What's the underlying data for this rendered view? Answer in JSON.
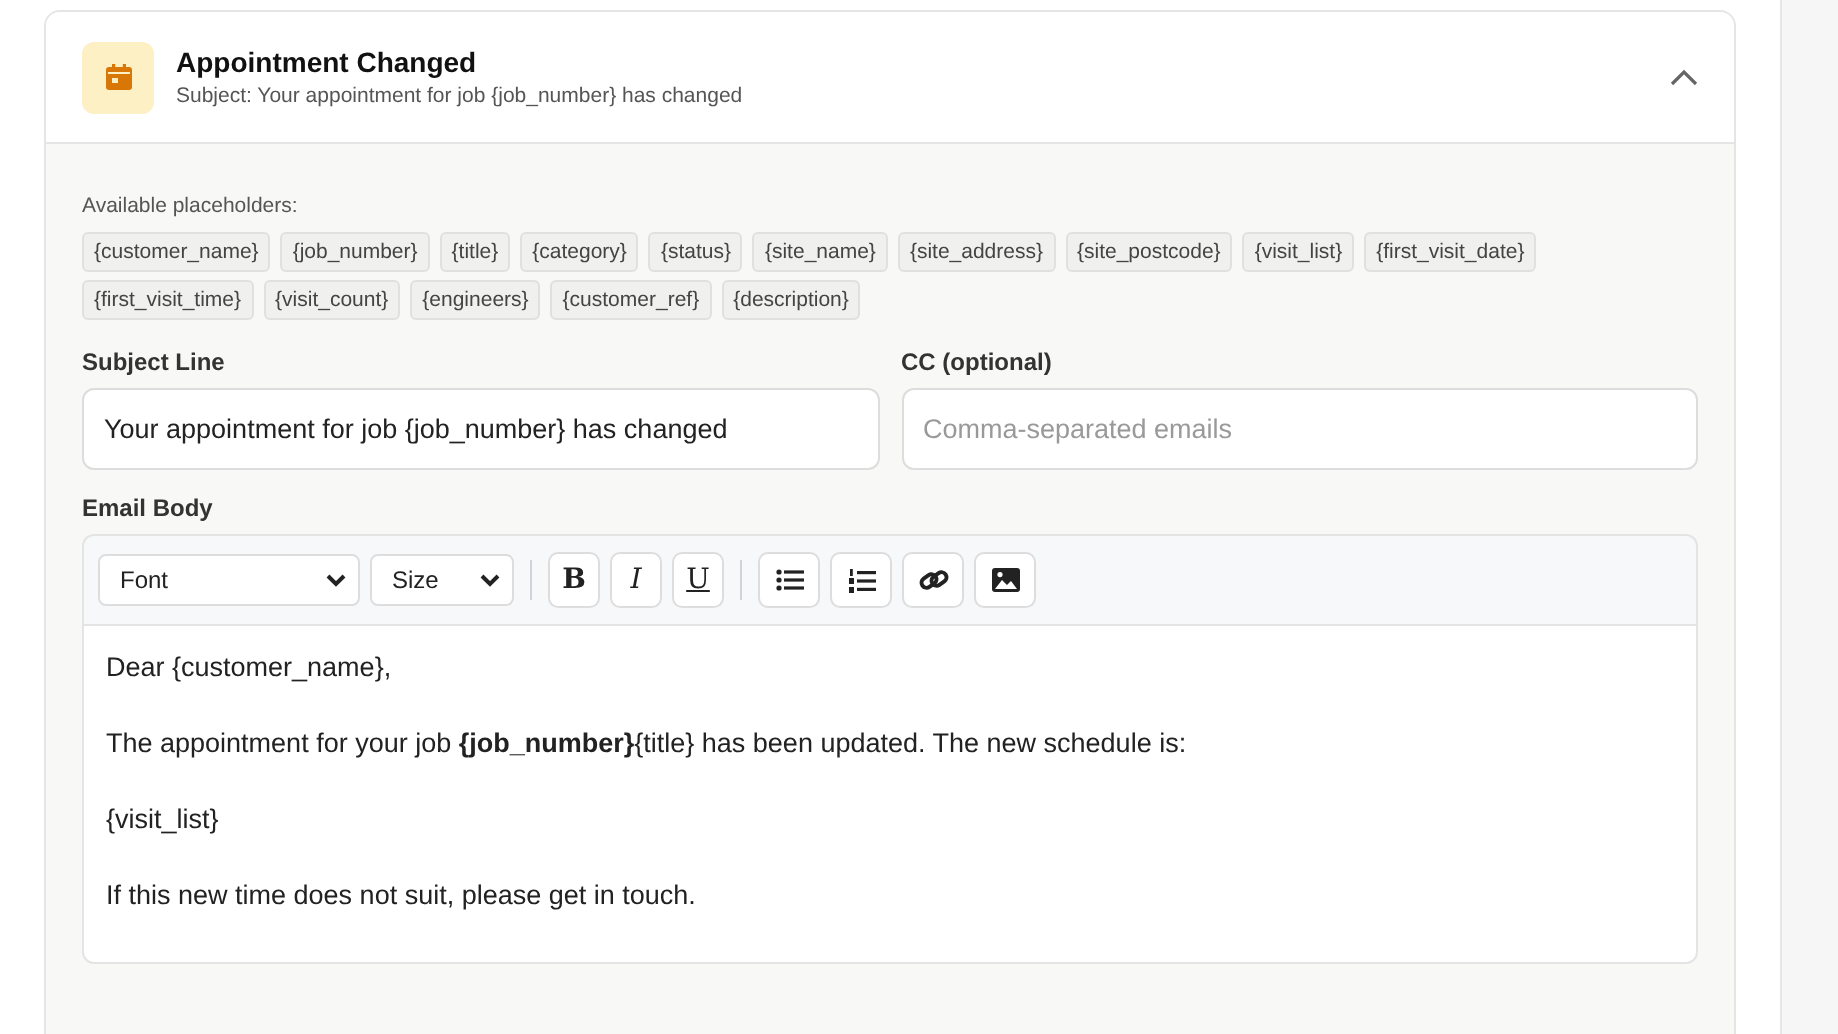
{
  "card": {
    "title": "Appointment Changed",
    "subtitle": "Subject: Your appointment for job {job_number} has changed",
    "expanded": true
  },
  "placeholders": {
    "label": "Available placeholders:",
    "items": [
      "{customer_name}",
      "{job_number}",
      "{title}",
      "{category}",
      "{status}",
      "{site_name}",
      "{site_address}",
      "{site_postcode}",
      "{visit_list}",
      "{first_visit_date}",
      "{first_visit_time}",
      "{visit_count}",
      "{engineers}",
      "{customer_ref}",
      "{description}"
    ]
  },
  "subject_field": {
    "label": "Subject Line",
    "value": "Your appointment for job {job_number} has changed"
  },
  "cc_field": {
    "label": "CC (optional)",
    "placeholder": "Comma-separated emails"
  },
  "email_body": {
    "label": "Email Body",
    "toolbar": [
      {
        "kind": "select",
        "label": "Font"
      },
      {
        "kind": "select",
        "label": "Size"
      },
      {
        "kind": "divider"
      },
      {
        "kind": "bold",
        "label": "B"
      },
      {
        "kind": "italic",
        "label": "I"
      },
      {
        "kind": "underline",
        "label": "U"
      },
      {
        "kind": "divider"
      },
      {
        "kind": "bullets"
      },
      {
        "kind": "numbering"
      },
      {
        "kind": "link"
      },
      {
        "kind": "image"
      }
    ],
    "paragraphs": [
      "Dear {customer_name},",
      "The appointment for your job **{job_number}**{title} has been updated. The new schedule is:",
      "{visit_list}",
      "If this new time does not suit, please get in touch."
    ]
  }
}
